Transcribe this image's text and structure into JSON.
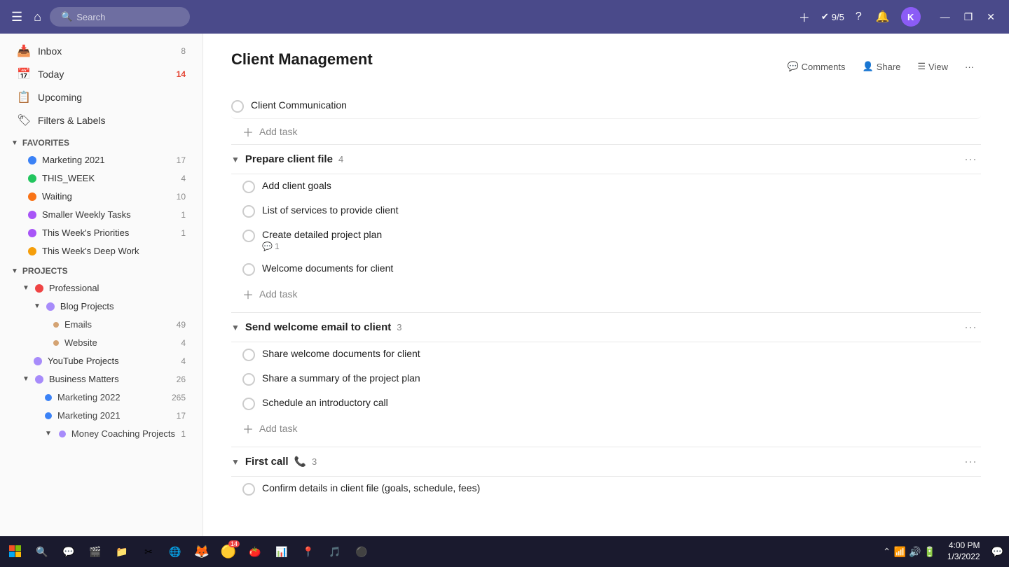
{
  "topbar": {
    "search_placeholder": "Search",
    "karma_label": "9/5",
    "avatar_initial": "K",
    "minimize": "—",
    "restore": "❐",
    "close": "✕"
  },
  "sidebar": {
    "inbox_label": "Inbox",
    "inbox_count": "8",
    "today_label": "Today",
    "today_count": "14",
    "upcoming_label": "Upcoming",
    "filters_label": "Filters & Labels",
    "favorites_header": "Favorites",
    "favorites": [
      {
        "label": "Marketing 2021",
        "color": "#3b82f6",
        "count": "17"
      },
      {
        "label": "THIS_WEEK",
        "color": "#22c55e",
        "count": "4"
      },
      {
        "label": "Waiting",
        "color": "#f97316",
        "count": "10"
      },
      {
        "label": "Smaller Weekly Tasks",
        "color": "#a855f7",
        "count": "1"
      },
      {
        "label": "This Week's Priorities",
        "color": "#a855f7",
        "count": "1"
      },
      {
        "label": "This Week's Deep Work",
        "color": "#f59e0b",
        "count": ""
      }
    ],
    "projects_header": "Projects",
    "projects": [
      {
        "label": "Professional",
        "color": "#ef4444",
        "expanded": true,
        "children": [
          {
            "label": "Blog Projects",
            "color": "#a78bfa",
            "expanded": true,
            "children": [
              {
                "label": "Emails",
                "color": "#d4a373",
                "count": "49"
              },
              {
                "label": "Website",
                "color": "#d4a373",
                "count": "4"
              }
            ]
          },
          {
            "label": "YouTube Projects",
            "color": "#a78bfa",
            "count": "4"
          }
        ]
      },
      {
        "label": "Business Matters",
        "color": "#a78bfa",
        "count": "26",
        "expanded": true,
        "children": [
          {
            "label": "Marketing 2022",
            "color": "#3b82f6",
            "count": "265"
          },
          {
            "label": "Marketing 2021",
            "color": "#3b82f6",
            "count": "17"
          },
          {
            "label": "Money Coaching Projects",
            "color": "#a78bfa",
            "count": "1"
          }
        ]
      }
    ]
  },
  "main": {
    "title": "Client Management",
    "actions": {
      "comments": "Comments",
      "share": "Share",
      "view": "View",
      "more": "···"
    },
    "standalone_task": {
      "name": "Client Communication"
    },
    "add_task_label": "Add task",
    "sections": [
      {
        "title": "Prepare client file",
        "count": "4",
        "tasks": [
          {
            "name": "Add client goals",
            "comment_count": ""
          },
          {
            "name": "List of services to provide client",
            "comment_count": ""
          },
          {
            "name": "Create detailed project plan",
            "comment_count": "1"
          },
          {
            "name": "Welcome documents for client",
            "comment_count": ""
          }
        ]
      },
      {
        "title": "Send welcome email to client",
        "count": "3",
        "tasks": [
          {
            "name": "Share welcome documents for client",
            "comment_count": ""
          },
          {
            "name": "Share a summary of the project plan",
            "comment_count": ""
          },
          {
            "name": "Schedule an introductory call",
            "comment_count": ""
          }
        ]
      },
      {
        "title": "First call",
        "count": "3",
        "phone_icon": "📞",
        "tasks": [
          {
            "name": "Confirm details in client file (goals, schedule, fees)",
            "comment_count": ""
          }
        ]
      }
    ]
  },
  "taskbar": {
    "apps": [
      {
        "icon": "⊞",
        "name": "start"
      },
      {
        "icon": "🔍",
        "name": "search"
      },
      {
        "icon": "💬",
        "name": "chat"
      },
      {
        "icon": "🎬",
        "name": "video"
      },
      {
        "icon": "📁",
        "name": "files"
      },
      {
        "icon": "✂",
        "name": "tools"
      },
      {
        "icon": "🌐",
        "name": "edge"
      },
      {
        "icon": "🦊",
        "name": "firefox"
      },
      {
        "icon": "🟡",
        "name": "chrome",
        "badge": "14"
      },
      {
        "icon": "🍅",
        "name": "todoist"
      },
      {
        "icon": "📊",
        "name": "sheets"
      },
      {
        "icon": "📍",
        "name": "maps"
      },
      {
        "icon": "🎵",
        "name": "spotify"
      },
      {
        "icon": "⚫",
        "name": "other"
      }
    ],
    "time": "4:00 PM",
    "date": "1/3/2022"
  }
}
